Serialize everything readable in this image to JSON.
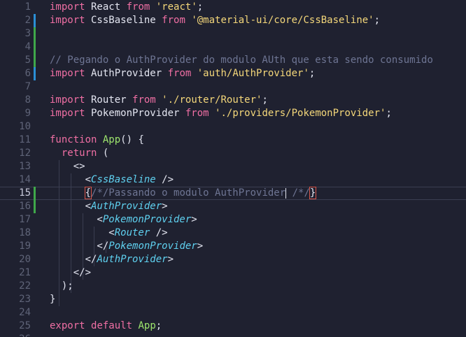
{
  "editor": {
    "language": "javascript",
    "current_line": 15,
    "colors": {
      "background": "#1f2130",
      "keyword": "#f06fa4",
      "string": "#f4d77a",
      "function": "#9ee66d",
      "jsx_tag": "#5fd1f0",
      "comment": "#6e7593",
      "gutter_modified": "#2a8fd6",
      "gutter_added": "#3fa84a"
    }
  },
  "lines": [
    {
      "n": "1",
      "tokens": [
        {
          "t": "kw",
          "v": "import"
        },
        {
          "t": "id",
          "v": " React "
        },
        {
          "t": "kw",
          "v": "from"
        },
        {
          "t": "id",
          "v": " "
        },
        {
          "t": "str",
          "v": "'react'"
        },
        {
          "t": "id",
          "v": ";"
        }
      ]
    },
    {
      "n": "2",
      "tokens": [
        {
          "t": "kw",
          "v": "import"
        },
        {
          "t": "id",
          "v": " CssBaseline "
        },
        {
          "t": "kw",
          "v": "from"
        },
        {
          "t": "id",
          "v": " "
        },
        {
          "t": "str",
          "v": "'@material-ui/core/CssBaseline'"
        },
        {
          "t": "id",
          "v": ";"
        }
      ]
    },
    {
      "n": "3",
      "tokens": []
    },
    {
      "n": "4",
      "tokens": []
    },
    {
      "n": "5",
      "tokens": [
        {
          "t": "comment",
          "v": "// Pegando o AuthProvider do modulo AUth que esta sendo consumido"
        }
      ]
    },
    {
      "n": "6",
      "tokens": [
        {
          "t": "kw",
          "v": "import"
        },
        {
          "t": "id",
          "v": " AuthProvider "
        },
        {
          "t": "kw",
          "v": "from"
        },
        {
          "t": "id",
          "v": " "
        },
        {
          "t": "str",
          "v": "'auth/AuthProvider'"
        },
        {
          "t": "id",
          "v": ";"
        }
      ]
    },
    {
      "n": "7",
      "tokens": []
    },
    {
      "n": "8",
      "tokens": [
        {
          "t": "kw",
          "v": "import"
        },
        {
          "t": "id",
          "v": " Router "
        },
        {
          "t": "kw",
          "v": "from"
        },
        {
          "t": "id",
          "v": " "
        },
        {
          "t": "str",
          "v": "'./router/Router'"
        },
        {
          "t": "id",
          "v": ";"
        }
      ]
    },
    {
      "n": "9",
      "tokens": [
        {
          "t": "kw",
          "v": "import"
        },
        {
          "t": "id",
          "v": " PokemonProvider "
        },
        {
          "t": "kw",
          "v": "from"
        },
        {
          "t": "id",
          "v": " "
        },
        {
          "t": "str",
          "v": "'./providers/PokemonProvider'"
        },
        {
          "t": "id",
          "v": ";"
        }
      ]
    },
    {
      "n": "10",
      "tokens": []
    },
    {
      "n": "11",
      "tokens": [
        {
          "t": "kw",
          "v": "function"
        },
        {
          "t": "id",
          "v": " "
        },
        {
          "t": "fn",
          "v": "App"
        },
        {
          "t": "id",
          "v": "() {"
        }
      ]
    },
    {
      "n": "12",
      "tokens": [
        {
          "t": "id",
          "v": "  "
        },
        {
          "t": "kw",
          "v": "return"
        },
        {
          "t": "id",
          "v": " ("
        }
      ]
    },
    {
      "n": "13",
      "tokens": [
        {
          "t": "id",
          "v": "    <>"
        }
      ]
    },
    {
      "n": "14",
      "tokens": [
        {
          "t": "id",
          "v": "      <"
        },
        {
          "t": "tag",
          "v": "CssBaseline"
        },
        {
          "t": "id",
          "v": " />"
        }
      ]
    },
    {
      "n": "15",
      "tokens": [
        {
          "t": "id",
          "v": "      "
        },
        {
          "t": "brace",
          "v": "{"
        },
        {
          "t": "comment",
          "v": "/*/Passando o modulo AuthProvider"
        },
        {
          "t": "cursor",
          "v": ""
        },
        {
          "t": "comment",
          "v": " /*/"
        },
        {
          "t": "brace",
          "v": "}"
        }
      ]
    },
    {
      "n": "16",
      "tokens": [
        {
          "t": "id",
          "v": "      <"
        },
        {
          "t": "tag",
          "v": "AuthProvider"
        },
        {
          "t": "id",
          "v": ">"
        }
      ]
    },
    {
      "n": "17",
      "tokens": [
        {
          "t": "id",
          "v": "        <"
        },
        {
          "t": "tag",
          "v": "PokemonProvider"
        },
        {
          "t": "id",
          "v": ">"
        }
      ]
    },
    {
      "n": "18",
      "tokens": [
        {
          "t": "id",
          "v": "          <"
        },
        {
          "t": "tag",
          "v": "Router"
        },
        {
          "t": "id",
          "v": " />"
        }
      ]
    },
    {
      "n": "19",
      "tokens": [
        {
          "t": "id",
          "v": "        </"
        },
        {
          "t": "tag",
          "v": "PokemonProvider"
        },
        {
          "t": "id",
          "v": ">"
        }
      ]
    },
    {
      "n": "20",
      "tokens": [
        {
          "t": "id",
          "v": "      </"
        },
        {
          "t": "tag",
          "v": "AuthProvider"
        },
        {
          "t": "id",
          "v": ">"
        }
      ]
    },
    {
      "n": "21",
      "tokens": [
        {
          "t": "id",
          "v": "    </>"
        }
      ]
    },
    {
      "n": "22",
      "tokens": [
        {
          "t": "id",
          "v": "  );"
        }
      ]
    },
    {
      "n": "23",
      "tokens": [
        {
          "t": "id",
          "v": "}"
        }
      ]
    },
    {
      "n": "24",
      "tokens": []
    },
    {
      "n": "25",
      "tokens": [
        {
          "t": "kw",
          "v": "export"
        },
        {
          "t": "id",
          "v": " "
        },
        {
          "t": "kw",
          "v": "default"
        },
        {
          "t": "id",
          "v": " "
        },
        {
          "t": "fn",
          "v": "App"
        },
        {
          "t": "id",
          "v": ";"
        }
      ]
    },
    {
      "n": "26",
      "tokens": []
    }
  ],
  "gutter_marks": [
    {
      "line": "2",
      "kind": "modified"
    },
    {
      "line": "3",
      "kind": "added"
    },
    {
      "line": "4",
      "kind": "added"
    },
    {
      "line": "5",
      "kind": "added"
    },
    {
      "line": "6",
      "kind": "modified"
    },
    {
      "line": "15",
      "kind": "added"
    },
    {
      "line": "16",
      "kind": "added"
    }
  ]
}
